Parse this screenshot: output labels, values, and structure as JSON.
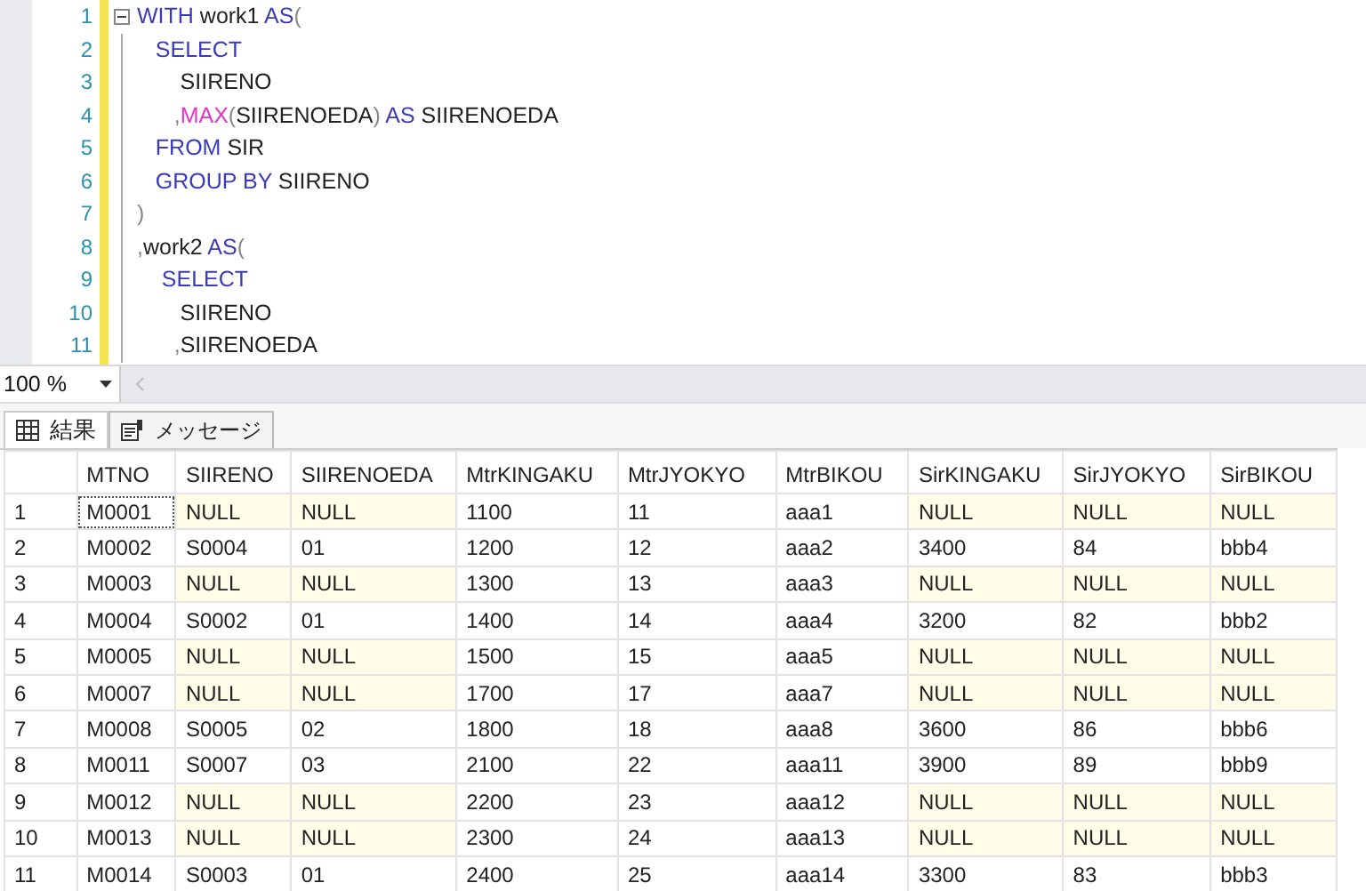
{
  "editor": {
    "lines": [
      {
        "number": "1",
        "fold": true,
        "tokens": [
          {
            "kind": "keyword",
            "text": "WITH"
          },
          {
            "kind": "plain",
            "text": " work1 "
          },
          {
            "kind": "keyword",
            "text": "AS"
          },
          {
            "kind": "punct",
            "text": "("
          }
        ]
      },
      {
        "number": "2",
        "fold": false,
        "tokens": [
          {
            "kind": "keyword",
            "text": "   SELECT"
          }
        ]
      },
      {
        "number": "3",
        "fold": false,
        "tokens": [
          {
            "kind": "plain",
            "text": "       SIIRENO"
          }
        ]
      },
      {
        "number": "4",
        "fold": false,
        "tokens": [
          {
            "kind": "punct",
            "text": "      ,"
          },
          {
            "kind": "func",
            "text": "MAX"
          },
          {
            "kind": "punct",
            "text": "("
          },
          {
            "kind": "plain",
            "text": "SIIRENOEDA"
          },
          {
            "kind": "punct",
            "text": ") "
          },
          {
            "kind": "keyword",
            "text": "AS"
          },
          {
            "kind": "plain",
            "text": " SIIRENOEDA"
          }
        ]
      },
      {
        "number": "5",
        "fold": false,
        "tokens": [
          {
            "kind": "keyword",
            "text": "   FROM"
          },
          {
            "kind": "plain",
            "text": " SIR"
          }
        ]
      },
      {
        "number": "6",
        "fold": false,
        "tokens": [
          {
            "kind": "keyword",
            "text": "   GROUP BY"
          },
          {
            "kind": "plain",
            "text": " SIIRENO"
          }
        ]
      },
      {
        "number": "7",
        "fold": false,
        "tokens": [
          {
            "kind": "punct",
            "text": ")"
          }
        ]
      },
      {
        "number": "8",
        "fold": false,
        "tokens": [
          {
            "kind": "punct",
            "text": ","
          },
          {
            "kind": "plain",
            "text": "work2 "
          },
          {
            "kind": "keyword",
            "text": "AS"
          },
          {
            "kind": "punct",
            "text": "("
          }
        ]
      },
      {
        "number": "9",
        "fold": false,
        "tokens": [
          {
            "kind": "keyword",
            "text": "    SELECT"
          }
        ]
      },
      {
        "number": "10",
        "fold": false,
        "tokens": [
          {
            "kind": "plain",
            "text": "       SIIRENO"
          }
        ]
      },
      {
        "number": "11",
        "fold": false,
        "tokens": [
          {
            "kind": "punct",
            "text": "      ,"
          },
          {
            "kind": "plain",
            "text": "SIIRENOEDA"
          }
        ]
      }
    ]
  },
  "zoom": {
    "value": "100 %"
  },
  "tabs": [
    {
      "label": "結果",
      "selected": true
    },
    {
      "label": "メッセージ",
      "selected": false
    }
  ],
  "table": {
    "columns": [
      "MTNO",
      "SIIRENO",
      "SIIRENOEDA",
      "MtrKINGAKU",
      "MtrJYOKYO",
      "MtrBIKOU",
      "SirKINGAKU",
      "SirJYOKYO",
      "SirBIKOU"
    ],
    "rows": [
      {
        "number": "1",
        "focused": true,
        "cells": [
          {
            "text": "M0001",
            "null": false
          },
          {
            "text": "NULL",
            "null": true
          },
          {
            "text": "NULL",
            "null": true
          },
          {
            "text": "1100",
            "null": false
          },
          {
            "text": "11",
            "null": false
          },
          {
            "text": "aaa1",
            "null": false
          },
          {
            "text": "NULL",
            "null": true
          },
          {
            "text": "NULL",
            "null": true
          },
          {
            "text": "NULL",
            "null": true
          }
        ]
      },
      {
        "number": "2",
        "focused": false,
        "cells": [
          {
            "text": "M0002",
            "null": false
          },
          {
            "text": "S0004",
            "null": false
          },
          {
            "text": "01",
            "null": false
          },
          {
            "text": "1200",
            "null": false
          },
          {
            "text": "12",
            "null": false
          },
          {
            "text": "aaa2",
            "null": false
          },
          {
            "text": "3400",
            "null": false
          },
          {
            "text": "84",
            "null": false
          },
          {
            "text": "bbb4",
            "null": false
          }
        ]
      },
      {
        "number": "3",
        "focused": false,
        "cells": [
          {
            "text": "M0003",
            "null": false
          },
          {
            "text": "NULL",
            "null": true
          },
          {
            "text": "NULL",
            "null": true
          },
          {
            "text": "1300",
            "null": false
          },
          {
            "text": "13",
            "null": false
          },
          {
            "text": "aaa3",
            "null": false
          },
          {
            "text": "NULL",
            "null": true
          },
          {
            "text": "NULL",
            "null": true
          },
          {
            "text": "NULL",
            "null": true
          }
        ]
      },
      {
        "number": "4",
        "focused": false,
        "cells": [
          {
            "text": "M0004",
            "null": false
          },
          {
            "text": "S0002",
            "null": false
          },
          {
            "text": "01",
            "null": false
          },
          {
            "text": "1400",
            "null": false
          },
          {
            "text": "14",
            "null": false
          },
          {
            "text": "aaa4",
            "null": false
          },
          {
            "text": "3200",
            "null": false
          },
          {
            "text": "82",
            "null": false
          },
          {
            "text": "bbb2",
            "null": false
          }
        ]
      },
      {
        "number": "5",
        "focused": false,
        "cells": [
          {
            "text": "M0005",
            "null": false
          },
          {
            "text": "NULL",
            "null": true
          },
          {
            "text": "NULL",
            "null": true
          },
          {
            "text": "1500",
            "null": false
          },
          {
            "text": "15",
            "null": false
          },
          {
            "text": "aaa5",
            "null": false
          },
          {
            "text": "NULL",
            "null": true
          },
          {
            "text": "NULL",
            "null": true
          },
          {
            "text": "NULL",
            "null": true
          }
        ]
      },
      {
        "number": "6",
        "focused": false,
        "cells": [
          {
            "text": "M0007",
            "null": false
          },
          {
            "text": "NULL",
            "null": true
          },
          {
            "text": "NULL",
            "null": true
          },
          {
            "text": "1700",
            "null": false
          },
          {
            "text": "17",
            "null": false
          },
          {
            "text": "aaa7",
            "null": false
          },
          {
            "text": "NULL",
            "null": true
          },
          {
            "text": "NULL",
            "null": true
          },
          {
            "text": "NULL",
            "null": true
          }
        ]
      },
      {
        "number": "7",
        "focused": false,
        "cells": [
          {
            "text": "M0008",
            "null": false
          },
          {
            "text": "S0005",
            "null": false
          },
          {
            "text": "02",
            "null": false
          },
          {
            "text": "1800",
            "null": false
          },
          {
            "text": "18",
            "null": false
          },
          {
            "text": "aaa8",
            "null": false
          },
          {
            "text": "3600",
            "null": false
          },
          {
            "text": "86",
            "null": false
          },
          {
            "text": "bbb6",
            "null": false
          }
        ]
      },
      {
        "number": "8",
        "focused": false,
        "cells": [
          {
            "text": "M0011",
            "null": false
          },
          {
            "text": "S0007",
            "null": false
          },
          {
            "text": "03",
            "null": false
          },
          {
            "text": "2100",
            "null": false
          },
          {
            "text": "22",
            "null": false
          },
          {
            "text": "aaa11",
            "null": false
          },
          {
            "text": "3900",
            "null": false
          },
          {
            "text": "89",
            "null": false
          },
          {
            "text": "bbb9",
            "null": false
          }
        ]
      },
      {
        "number": "9",
        "focused": false,
        "cells": [
          {
            "text": "M0012",
            "null": false
          },
          {
            "text": "NULL",
            "null": true
          },
          {
            "text": "NULL",
            "null": true
          },
          {
            "text": "2200",
            "null": false
          },
          {
            "text": "23",
            "null": false
          },
          {
            "text": "aaa12",
            "null": false
          },
          {
            "text": "NULL",
            "null": true
          },
          {
            "text": "NULL",
            "null": true
          },
          {
            "text": "NULL",
            "null": true
          }
        ]
      },
      {
        "number": "10",
        "focused": false,
        "cells": [
          {
            "text": "M0013",
            "null": false
          },
          {
            "text": "NULL",
            "null": true
          },
          {
            "text": "NULL",
            "null": true
          },
          {
            "text": "2300",
            "null": false
          },
          {
            "text": "24",
            "null": false
          },
          {
            "text": "aaa13",
            "null": false
          },
          {
            "text": "NULL",
            "null": true
          },
          {
            "text": "NULL",
            "null": true
          },
          {
            "text": "NULL",
            "null": true
          }
        ]
      },
      {
        "number": "11",
        "focused": false,
        "cells": [
          {
            "text": "M0014",
            "null": false
          },
          {
            "text": "S0003",
            "null": false
          },
          {
            "text": "01",
            "null": false
          },
          {
            "text": "2400",
            "null": false
          },
          {
            "text": "25",
            "null": false
          },
          {
            "text": "aaa14",
            "null": false
          },
          {
            "text": "3300",
            "null": false
          },
          {
            "text": "83",
            "null": false
          },
          {
            "text": "bbb3",
            "null": false
          }
        ]
      }
    ]
  }
}
